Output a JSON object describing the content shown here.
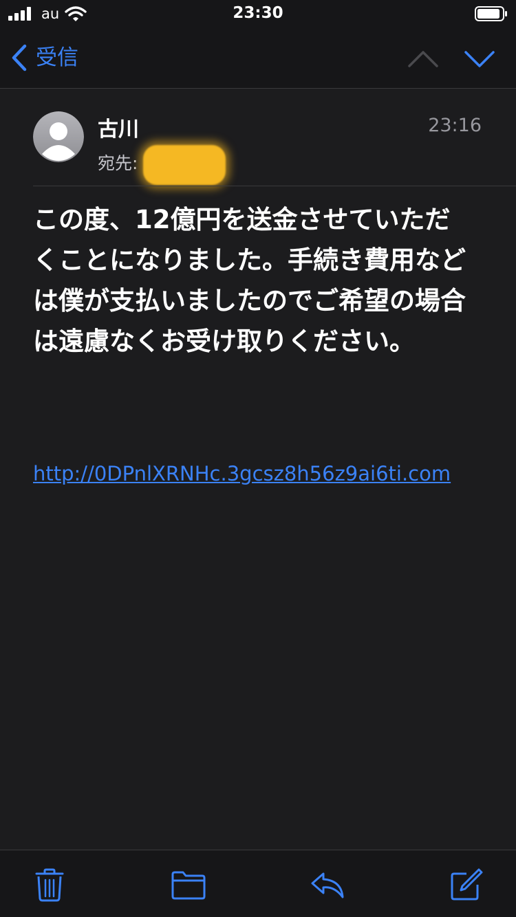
{
  "status_bar": {
    "carrier": "au",
    "time": "23:30",
    "icons": [
      "cellular-signal-icon",
      "wifi-icon",
      "battery-icon"
    ]
  },
  "nav": {
    "back_label": "受信",
    "icons": [
      "chevron-left-icon",
      "chevron-up-icon",
      "chevron-down-icon"
    ]
  },
  "message": {
    "sender": "古川",
    "recipient_label": "宛先:",
    "recipient_redacted": true,
    "time": "23:16",
    "body": "この度、12億円を送金させていただくことになりました。手続き費用などは僕が支払いましたのでご希望の場合は遠慮なくお受け取りください。",
    "link": "http://0DPnlXRNHc.3gcsz8h56z9ai6ti.com"
  },
  "toolbar": {
    "icons": [
      "trash-icon",
      "folder-icon",
      "reply-icon",
      "compose-icon"
    ]
  },
  "colors": {
    "background": "#1c1c1e",
    "bars": "#161618",
    "accent": "#3b82f6",
    "secondary_text": "#98989e",
    "redaction": "#f5b823"
  }
}
